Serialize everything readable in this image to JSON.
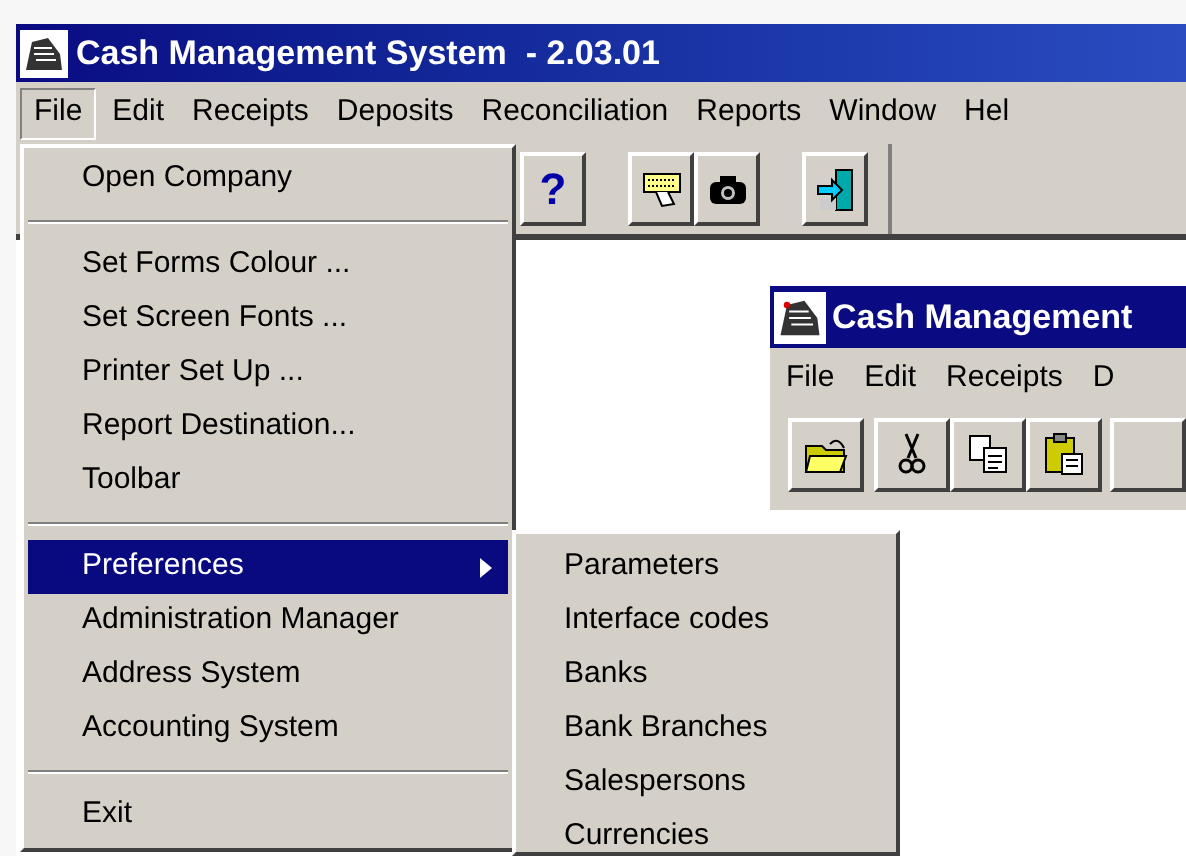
{
  "window": {
    "title": "Cash Management System  - 2.03.01"
  },
  "menu_bar": [
    {
      "label": "File",
      "selected": true
    },
    {
      "label": "Edit",
      "selected": false
    },
    {
      "label": "Receipts",
      "selected": false
    },
    {
      "label": "Deposits",
      "selected": false
    },
    {
      "label": "Reconciliation",
      "selected": false
    },
    {
      "label": "Reports",
      "selected": false
    },
    {
      "label": "Window",
      "selected": false
    },
    {
      "label": "Hel",
      "selected": false
    }
  ],
  "toolbar": [
    {
      "kind": "help",
      "glyph": "?"
    },
    {
      "kind": "gap"
    },
    {
      "kind": "keyboard"
    },
    {
      "kind": "camera"
    },
    {
      "kind": "gap"
    },
    {
      "kind": "exit"
    }
  ],
  "file_menu": [
    {
      "kind": "item",
      "label": "Open Company",
      "selected": false,
      "submenu": false
    },
    {
      "kind": "separator"
    },
    {
      "kind": "item",
      "label": "Set Forms Colour ...",
      "selected": false,
      "submenu": false
    },
    {
      "kind": "item",
      "label": "Set Screen Fonts ...",
      "selected": false,
      "submenu": false
    },
    {
      "kind": "item",
      "label": "Printer Set Up ...",
      "selected": false,
      "submenu": false
    },
    {
      "kind": "item",
      "label": "Report Destination...",
      "selected": false,
      "submenu": false
    },
    {
      "kind": "item",
      "label": "Toolbar",
      "selected": false,
      "submenu": false
    },
    {
      "kind": "separator"
    },
    {
      "kind": "item",
      "label": "Preferences",
      "selected": true,
      "submenu": true
    },
    {
      "kind": "item",
      "label": "Administration Manager",
      "selected": false,
      "submenu": false
    },
    {
      "kind": "item",
      "label": "Address System",
      "selected": false,
      "submenu": false
    },
    {
      "kind": "item",
      "label": "Accounting System",
      "selected": false,
      "submenu": false
    },
    {
      "kind": "separator"
    },
    {
      "kind": "item",
      "label": "Exit",
      "selected": false,
      "submenu": false
    }
  ],
  "preferences_submenu": [
    "Parameters",
    "Interface codes",
    "Banks",
    "Bank Branches",
    "Salespersons",
    "Currencies"
  ],
  "second_window": {
    "title": "Cash Management",
    "menu_bar": [
      "File",
      "Edit",
      "Receipts",
      "D"
    ],
    "toolbar": [
      {
        "kind": "open"
      },
      {
        "kind": "gap"
      },
      {
        "kind": "cut"
      },
      {
        "kind": "copy"
      },
      {
        "kind": "paste"
      },
      {
        "kind": "gap"
      },
      {
        "kind": "blank"
      }
    ]
  }
}
